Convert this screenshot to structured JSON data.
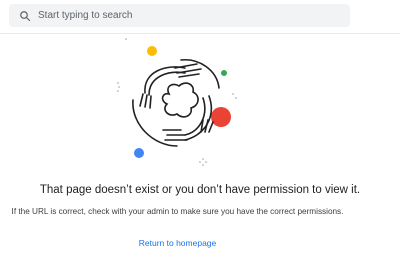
{
  "search": {
    "placeholder": "Start typing to search",
    "icon": "search-icon"
  },
  "error": {
    "headline": "That page doesn’t exist or you don’t have permission to view it.",
    "subtext": "If the URL is correct, check with your admin to make sure you have the correct permissions.",
    "link_label": "Return to homepage"
  },
  "illustration": {
    "description_icon": "swirling-hands-illustration",
    "colors": {
      "yellow": "#fbbc04",
      "green": "#34a853",
      "red": "#ea4335",
      "blue": "#4285f4",
      "line": "#202124"
    }
  },
  "colors": {
    "link": "#1a73e8",
    "search_bg": "#f1f3f4",
    "text": "#202124"
  }
}
